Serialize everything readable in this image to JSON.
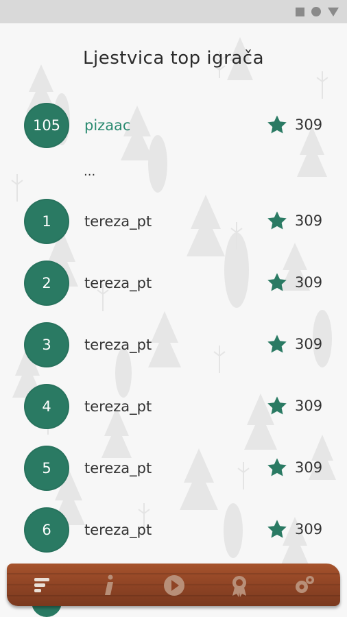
{
  "title": "Ljestvica top igrača",
  "current_player": {
    "rank": "105",
    "name": "pizaac",
    "score": "309"
  },
  "ellipsis": "...",
  "leaderboard": [
    {
      "rank": "1",
      "name": "tereza_pt",
      "score": "309"
    },
    {
      "rank": "2",
      "name": "tereza_pt",
      "score": "309"
    },
    {
      "rank": "3",
      "name": "tereza_pt",
      "score": "309"
    },
    {
      "rank": "4",
      "name": "tereza_pt",
      "score": "309"
    },
    {
      "rank": "5",
      "name": "tereza_pt",
      "score": "309"
    },
    {
      "rank": "6",
      "name": "tereza_pt",
      "score": "309"
    }
  ],
  "bottom_nav": [
    {
      "icon": "leaderboard-icon"
    },
    {
      "icon": "info-icon"
    },
    {
      "icon": "play-icon"
    },
    {
      "icon": "award-icon"
    },
    {
      "icon": "settings-icon"
    }
  ],
  "colors": {
    "accent": "#2a7a63",
    "wood": "#8f4425",
    "status_bar": "#d9d9d9"
  }
}
